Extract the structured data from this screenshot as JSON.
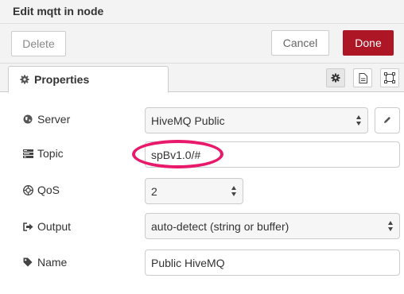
{
  "header": {
    "title": "Edit mqtt in node"
  },
  "toolbar": {
    "delete_label": "Delete",
    "cancel_label": "Cancel",
    "done_label": "Done"
  },
  "tabs": {
    "properties_label": "Properties"
  },
  "form": {
    "server": {
      "label": "Server",
      "value": "HiveMQ Public"
    },
    "topic": {
      "label": "Topic",
      "value": "spBv1.0/#"
    },
    "qos": {
      "label": "QoS",
      "value": "2"
    },
    "output": {
      "label": "Output",
      "value": "auto-detect (string or buffer)"
    },
    "name": {
      "label": "Name",
      "value": "Public HiveMQ"
    }
  },
  "colors": {
    "done_button": "#ad1625",
    "highlight_ring": "#e8196a"
  },
  "icons": [
    "gear-icon",
    "globe-icon",
    "tasks-icon",
    "qos-icon",
    "sign-out-icon",
    "tag-icon",
    "pencil-icon",
    "file-icon",
    "frame-icon",
    "gear-tab-icon"
  ]
}
